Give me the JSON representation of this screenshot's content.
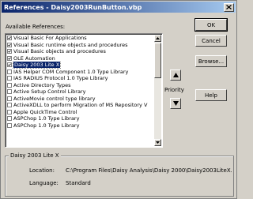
{
  "window": {
    "title": "References - Daisy2003RunButton.vbp"
  },
  "list": {
    "label": "Available References:",
    "items": [
      {
        "checked": true,
        "label": "Visual Basic For Applications"
      },
      {
        "checked": true,
        "label": "Visual Basic runtime objects and procedures"
      },
      {
        "checked": true,
        "label": "Visual Basic objects and procedures"
      },
      {
        "checked": true,
        "label": "OLE Automation"
      },
      {
        "checked": true,
        "label": "Daisy 2003 Lite X",
        "selected": true
      },
      {
        "checked": false,
        "label": "IAS Helper COM Component 1.0 Type Library"
      },
      {
        "checked": false,
        "label": "IAS RADIUS Protocol 1.0 Type Library"
      },
      {
        "checked": false,
        "label": "Active Directory Types"
      },
      {
        "checked": false,
        "label": "Active Setup Control Library"
      },
      {
        "checked": false,
        "label": "ActiveMovie control type library"
      },
      {
        "checked": false,
        "label": "ActiveXDLL to perform Migration of MS Repository V"
      },
      {
        "checked": false,
        "label": "Apple QuickTime Control"
      },
      {
        "checked": false,
        "label": "ASPChop 1.0 Type Library"
      },
      {
        "checked": false,
        "label": "ASPChop 1.0 Type Library"
      }
    ]
  },
  "buttons": {
    "ok": "OK",
    "cancel": "Cancel",
    "browse": "Browse...",
    "help": "Help"
  },
  "priority": {
    "label": "Priority"
  },
  "details": {
    "title": "Daisy 2003 Lite X",
    "location_label": "Location:",
    "location_value": "C:\\Program Files\\Daisy Analysis\\Daisy 2000\\Daisy2003LiteX.o",
    "language_label": "Language:",
    "language_value": "Standard"
  }
}
